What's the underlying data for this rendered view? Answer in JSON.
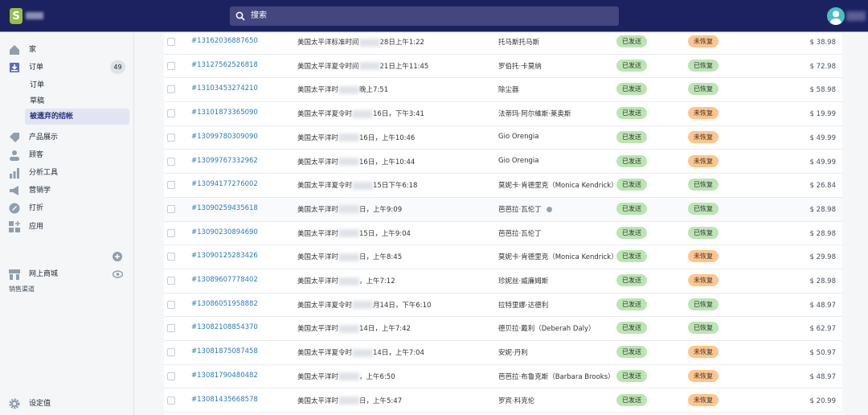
{
  "header": {
    "search_placeholder": "搜索"
  },
  "sidebar": {
    "items": [
      {
        "label": "家"
      },
      {
        "label": "订单",
        "badge": "49"
      },
      {
        "label": "产品展示"
      },
      {
        "label": "顾客"
      },
      {
        "label": "分析工具"
      },
      {
        "label": "营销学"
      },
      {
        "label": "打折"
      },
      {
        "label": "应用"
      }
    ],
    "order_sub": [
      {
        "label": "订单"
      },
      {
        "label": "草稿"
      },
      {
        "label": "被遗弃的结帐"
      }
    ],
    "channels_label": "销售渠道",
    "online_store": "网上商城",
    "settings": "设定值"
  },
  "orders": [
    {
      "id": "#13162036887650",
      "date_pre": "美国太平洋标准时间",
      "date_post": "28日上午1:22",
      "customer": "托马斯托马斯",
      "email": "已发送",
      "recovery": "未恢复",
      "amount": "$ 38.98"
    },
    {
      "id": "#13127562526818",
      "date_pre": "美国太平洋夏令时间",
      "date_post": "21日上午11:45",
      "customer": "罗伯托·卡莫纳",
      "email": "已发送",
      "recovery": "已恢复",
      "amount": "$ 72.98"
    },
    {
      "id": "#13103453274210",
      "date_pre": "美国太平洋时",
      "date_post": "晚上7:51",
      "customer": "除尘器",
      "email": "已发送",
      "recovery": "已恢复",
      "amount": "$ 58.98"
    },
    {
      "id": "#13101873365090",
      "date_pre": "美国太平洋夏令时",
      "date_post": "16日，下午3:41",
      "customer": "法蒂玛·阿尔維斯·莱奥斯",
      "email": "已发送",
      "recovery": "未恢复",
      "amount": "$ 19.99"
    },
    {
      "id": "#13099780309090",
      "date_pre": "美国太平洋时",
      "date_post": "16日，上午10:46",
      "customer": "Gio Orengia",
      "email": "已发送",
      "recovery": "未恢复",
      "amount": "$ 49.99"
    },
    {
      "id": "#13099767332962",
      "date_pre": "美国太平洋时",
      "date_post": "16日，上午10:44",
      "customer": "Gio Orengia",
      "email": "已发送",
      "recovery": "未恢复",
      "amount": "$ 49.99"
    },
    {
      "id": "#13094177276002",
      "date_pre": "美国太平洋夏令时",
      "date_post": "15日下午6:18",
      "customer": "莫妮卡·肯德里克（Monica Kendrick）",
      "email": "已发送",
      "recovery": "已恢复",
      "amount": "$ 26.84"
    },
    {
      "id": "#13090259435618",
      "date_pre": "美国太平洋时",
      "date_post": "日，上午9:09",
      "customer": "芭芭拉·瓦伦丁",
      "email": "已发送",
      "recovery": "已恢复",
      "amount": "$ 28.98"
    },
    {
      "id": "#13090230894690",
      "date_pre": "美国太平洋时",
      "date_post": "15日，上午9:04",
      "customer": "芭芭拉·瓦伦丁",
      "email": "已发送",
      "recovery": "已恢复",
      "amount": "$ 28.98"
    },
    {
      "id": "#13090125283426",
      "date_pre": "美国太平洋时",
      "date_post": "日，上午8:45",
      "customer": "莫妮卡·肯德里克（Monica Kendrick）",
      "email": "已发送",
      "recovery": "未恢复",
      "amount": "$ 29.98"
    },
    {
      "id": "#13089607778402",
      "date_pre": "美国太平洋时",
      "date_post": "，上午7:12",
      "customer": "珍妮丝·威廉姆斯",
      "email": "已发送",
      "recovery": "未恢复",
      "amount": "$ 28.98"
    },
    {
      "id": "#13086051958882",
      "date_pre": "美国太平洋夏令时",
      "date_post": "月14日，下午6:10",
      "customer": "拉特里娜·达德利",
      "email": "已发送",
      "recovery": "已恢复",
      "amount": "$ 48.97"
    },
    {
      "id": "#13082108854370",
      "date_pre": "美国太平洋时",
      "date_post": "14日，上午7:42",
      "customer": "德贝拉·戴利（Deberah Daly）",
      "email": "已发送",
      "recovery": "已恢复",
      "amount": "$ 62.97"
    },
    {
      "id": "#13081875087458",
      "date_pre": "美国太平洋夏令时",
      "date_post": "14日，上午7:04",
      "customer": "安妮·丹利",
      "email": "已发送",
      "recovery": "未恢复",
      "amount": "$ 50.97"
    },
    {
      "id": "#13081790480482",
      "date_pre": "美国太平洋时",
      "date_post": "，上午6:50",
      "customer": "芭芭拉·布鲁克斯（Barbara Brooks）",
      "email": "已发送",
      "recovery": "未恢复",
      "amount": "$ 48.97"
    },
    {
      "id": "#13081435668578",
      "date_pre": "美国太平洋时",
      "date_post": "日，上午5:47",
      "customer": "罗宾·科克伦",
      "email": "已发送",
      "recovery": "未恢复",
      "amount": "$ 20.99"
    }
  ]
}
